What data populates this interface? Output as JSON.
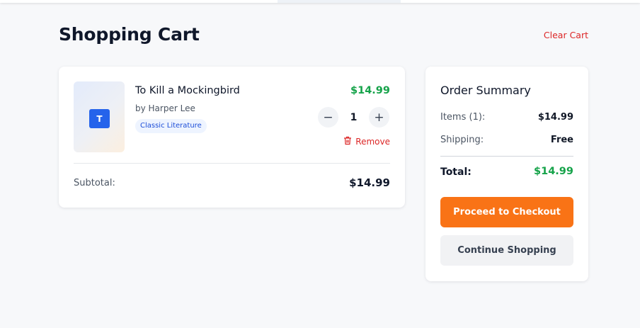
{
  "header": {
    "title": "Shopping Cart",
    "clear_cart_label": "Clear Cart"
  },
  "cart": {
    "items": [
      {
        "thumb_letter": "T",
        "title": "To Kill a Mockingbird",
        "author": "by Harper Lee",
        "category": "Classic Literature",
        "price": "$14.99",
        "quantity": "1",
        "decrement_symbol": "−",
        "increment_symbol": "+",
        "remove_label": "Remove",
        "remove_icon": "trash-icon"
      }
    ],
    "subtotal_label": "Subtotal:",
    "subtotal_value": "$14.99"
  },
  "summary": {
    "title": "Order Summary",
    "items_label": "Items (1):",
    "items_value": "$14.99",
    "shipping_label": "Shipping:",
    "shipping_value": "Free",
    "total_label": "Total:",
    "total_value": "$14.99",
    "checkout_label": "Proceed to Checkout",
    "continue_label": "Continue Shopping"
  },
  "colors": {
    "accent_orange": "#f97316",
    "price_green": "#16a34a",
    "danger_red": "#dc2626",
    "badge_blue": "#2563eb"
  }
}
